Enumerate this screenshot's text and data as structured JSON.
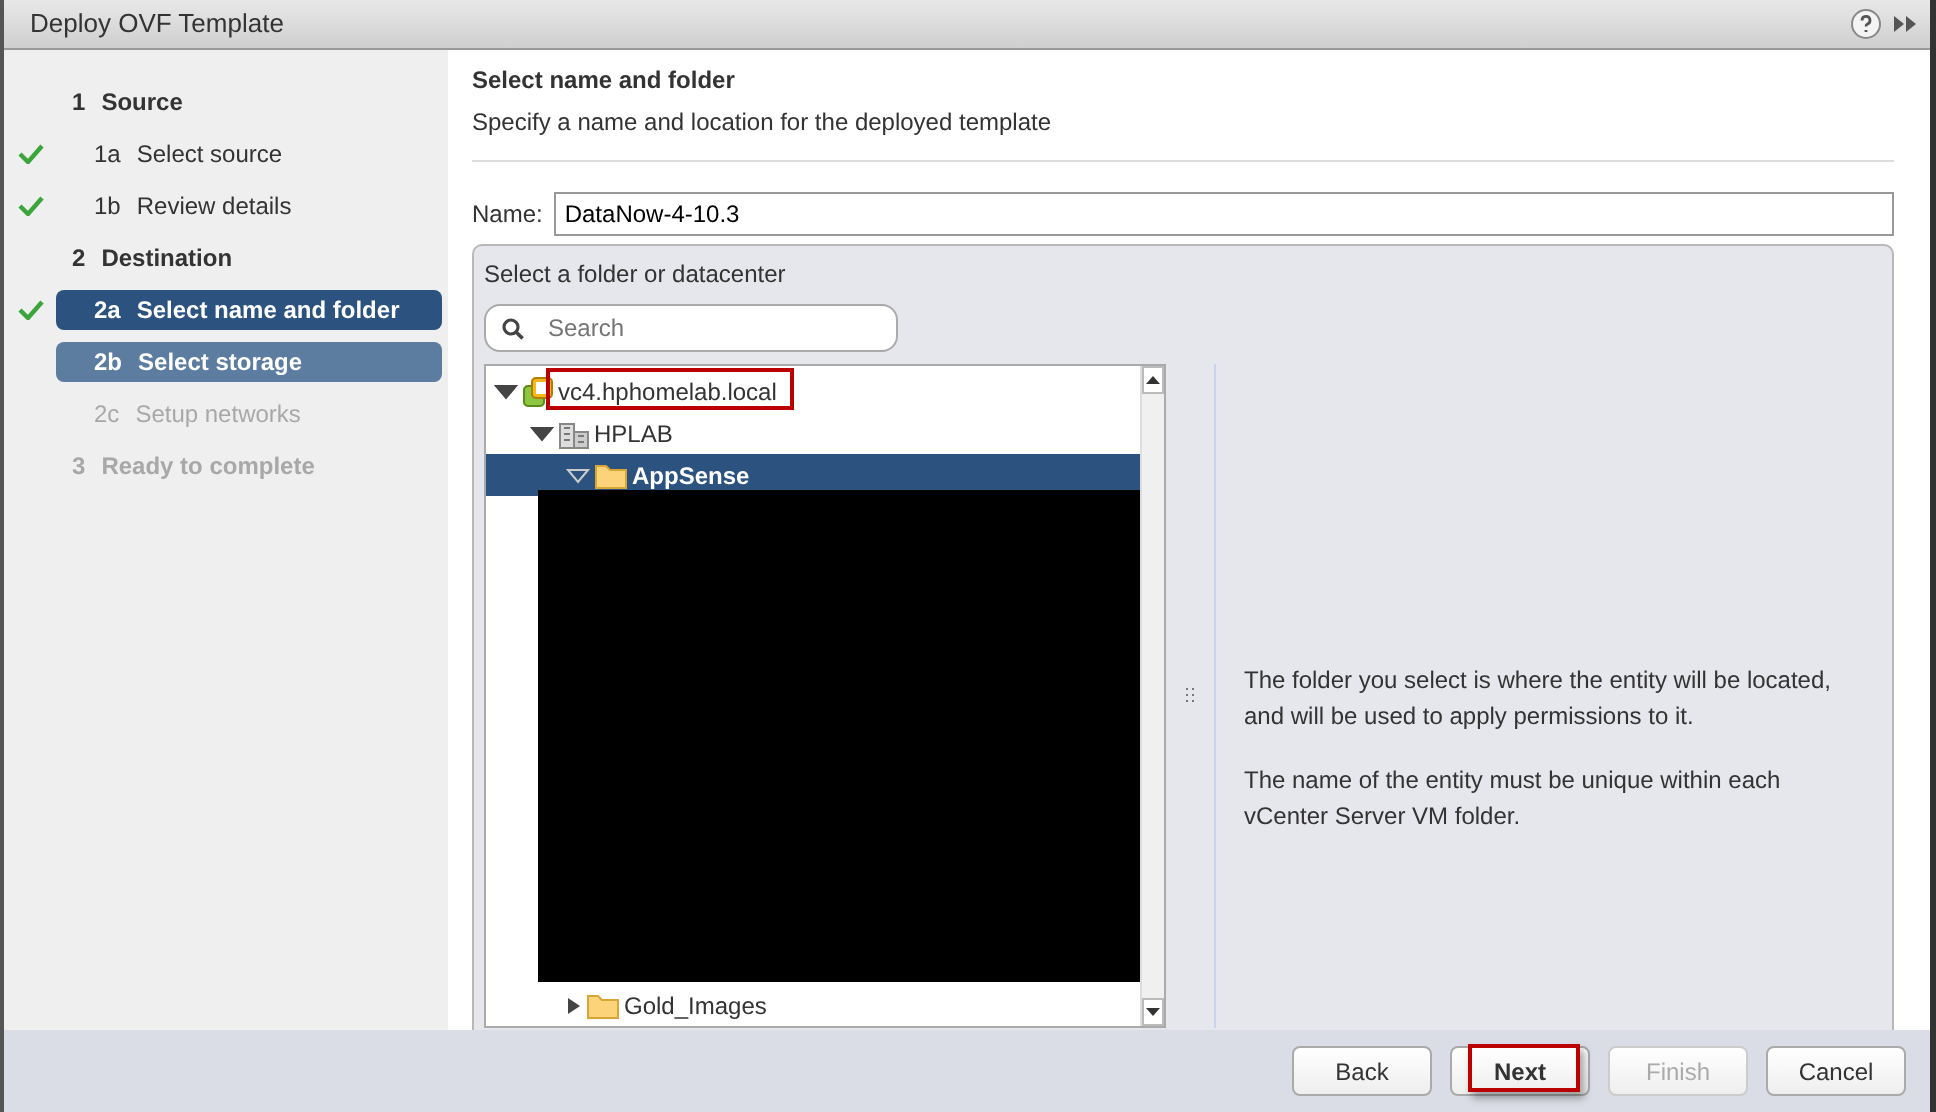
{
  "window": {
    "title": "Deploy OVF Template"
  },
  "steps": [
    {
      "number": "1",
      "label": "Source",
      "kind": "group",
      "checked": false,
      "selected": false,
      "highlighted": false,
      "disabled": false
    },
    {
      "number": "1a",
      "label": "Select source",
      "kind": "step",
      "checked": true,
      "selected": false,
      "highlighted": false,
      "disabled": false
    },
    {
      "number": "1b",
      "label": "Review details",
      "kind": "step",
      "checked": true,
      "selected": false,
      "highlighted": false,
      "disabled": false
    },
    {
      "number": "2",
      "label": "Destination",
      "kind": "group",
      "checked": false,
      "selected": false,
      "highlighted": false,
      "disabled": false
    },
    {
      "number": "2a",
      "label": "Select name and folder",
      "kind": "step",
      "checked": true,
      "selected": true,
      "highlighted": false,
      "disabled": false
    },
    {
      "number": "2b",
      "label": "Select storage",
      "kind": "step",
      "checked": false,
      "selected": false,
      "highlighted": true,
      "disabled": false
    },
    {
      "number": "2c",
      "label": "Setup networks",
      "kind": "step",
      "checked": false,
      "selected": false,
      "highlighted": false,
      "disabled": true
    },
    {
      "number": "3",
      "label": "Ready to complete",
      "kind": "group",
      "checked": false,
      "selected": false,
      "highlighted": false,
      "disabled": true
    }
  ],
  "page": {
    "title": "Select name and folder",
    "subtitle": "Specify a name and location for the deployed template"
  },
  "name_field": {
    "label": "Name:",
    "value": "DataNow-4-10.3"
  },
  "folder_panel": {
    "label": "Select a folder or datacenter",
    "search": {
      "placeholder": "Search"
    },
    "tree": [
      {
        "label": "vc4.hphomelab.local",
        "kind": "vcenter",
        "expanded": true,
        "selected": false,
        "children": [
          {
            "label": "HPLAB",
            "kind": "datacenter",
            "expanded": true,
            "selected": false,
            "children": [
              {
                "label": "AppSense",
                "kind": "folder",
                "expanded": true,
                "selected": true
              }
            ]
          }
        ]
      }
    ],
    "tree_bottom": {
      "label": "Gold_Images",
      "kind": "folder",
      "expanded": false,
      "selected": false
    },
    "info": [
      "The folder you select is where the entity will be located, and will be used to apply permissions to it.",
      "The name of the entity must be unique within each vCenter Server VM folder."
    ]
  },
  "buttons": [
    {
      "label": "Back",
      "disabled": false,
      "primary": false
    },
    {
      "label": "Next",
      "disabled": false,
      "primary": true
    },
    {
      "label": "Finish",
      "disabled": true,
      "primary": false
    },
    {
      "label": "Cancel",
      "disabled": false,
      "primary": false
    }
  ]
}
